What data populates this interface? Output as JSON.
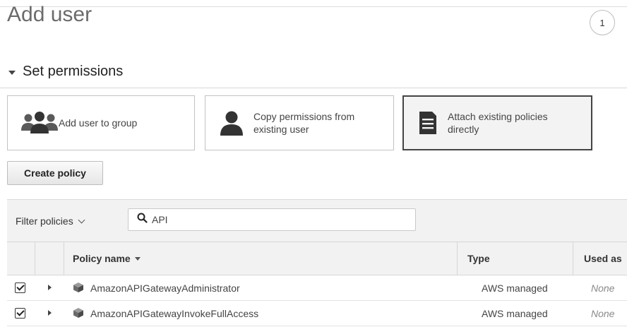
{
  "page": {
    "title": "Add user",
    "step_number": "1"
  },
  "section": {
    "title": "Set permissions"
  },
  "permission_options": [
    {
      "label": "Add user to group",
      "icon": "users-group-icon",
      "selected": false
    },
    {
      "label_line1": "Copy permissions from",
      "label_line2": "existing user",
      "icon": "user-icon",
      "selected": false
    },
    {
      "label_line1": "Attach existing policies",
      "label_line2": "directly",
      "icon": "document-icon",
      "selected": true
    }
  ],
  "create_policy_button": "Create policy",
  "filter": {
    "label": "Filter policies",
    "search_value": "API"
  },
  "table": {
    "columns": [
      "Policy name",
      "Type",
      "Used as"
    ],
    "rows": [
      {
        "checked": true,
        "name": "AmazonAPIGatewayAdministrator",
        "type": "AWS managed",
        "used_as": "None"
      },
      {
        "checked": true,
        "name": "AmazonAPIGatewayInvokeFullAccess",
        "type": "AWS managed",
        "used_as": "None"
      }
    ]
  }
}
